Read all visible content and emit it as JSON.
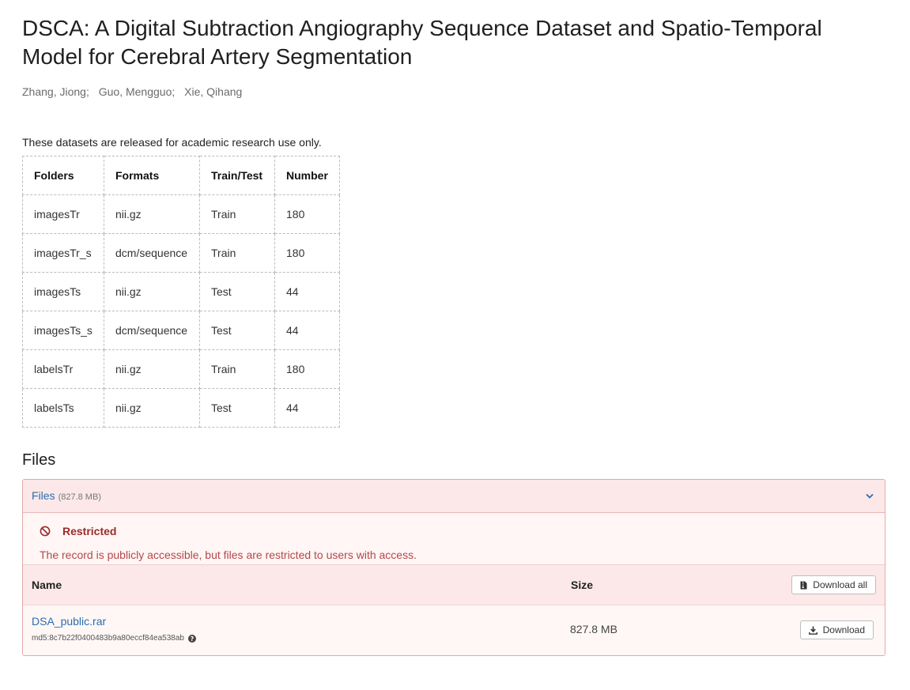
{
  "record": {
    "title": "DSCA: A Digital Subtraction Angiography Sequence Dataset and Spatio-Temporal Model for Cerebral Artery Segmentation",
    "authors": [
      "Zhang, Jiong",
      "Guo, Mengguo",
      "Xie, Qihang"
    ],
    "notice": "These datasets are released for academic research use only."
  },
  "dataset_table": {
    "headers": [
      "Folders",
      "Formats",
      "Train/Test",
      "Number"
    ],
    "rows": [
      [
        "imagesTr",
        "nii.gz",
        "Train",
        "180"
      ],
      [
        "imagesTr_s",
        "dcm/sequence",
        "Train",
        "180"
      ],
      [
        "imagesTs",
        "nii.gz",
        "Test",
        "44"
      ],
      [
        "imagesTs_s",
        "dcm/sequence",
        "Test",
        "44"
      ],
      [
        "labelsTr",
        "nii.gz",
        "Train",
        "180"
      ],
      [
        "labelsTs",
        "nii.gz",
        "Test",
        "44"
      ]
    ]
  },
  "files_section": {
    "heading": "Files",
    "panel_label": "Files",
    "panel_size": "(827.8 MB)",
    "restricted_title": "Restricted",
    "restricted_message": "The record is publicly accessible, but files are restricted to users with access.",
    "col_name": "Name",
    "col_size": "Size",
    "download_all_label": "Download all",
    "files": [
      {
        "name": "DSA_public.rar",
        "md5": "md5:8c7b22f0400483b9a80eccf84ea538ab",
        "size": "827.8 MB",
        "download_label": "Download"
      }
    ]
  },
  "colors": {
    "link": "#2a6db1",
    "restricted_text": "#9a2b2b",
    "panel_bg": "#fce8e8",
    "panel_border": "#e1aaaa"
  },
  "icons": {
    "chevron": "chevron-down-icon",
    "restricted": "ban-icon",
    "download_all": "file-archive-icon",
    "download": "download-icon",
    "help": "question-circle-icon"
  }
}
